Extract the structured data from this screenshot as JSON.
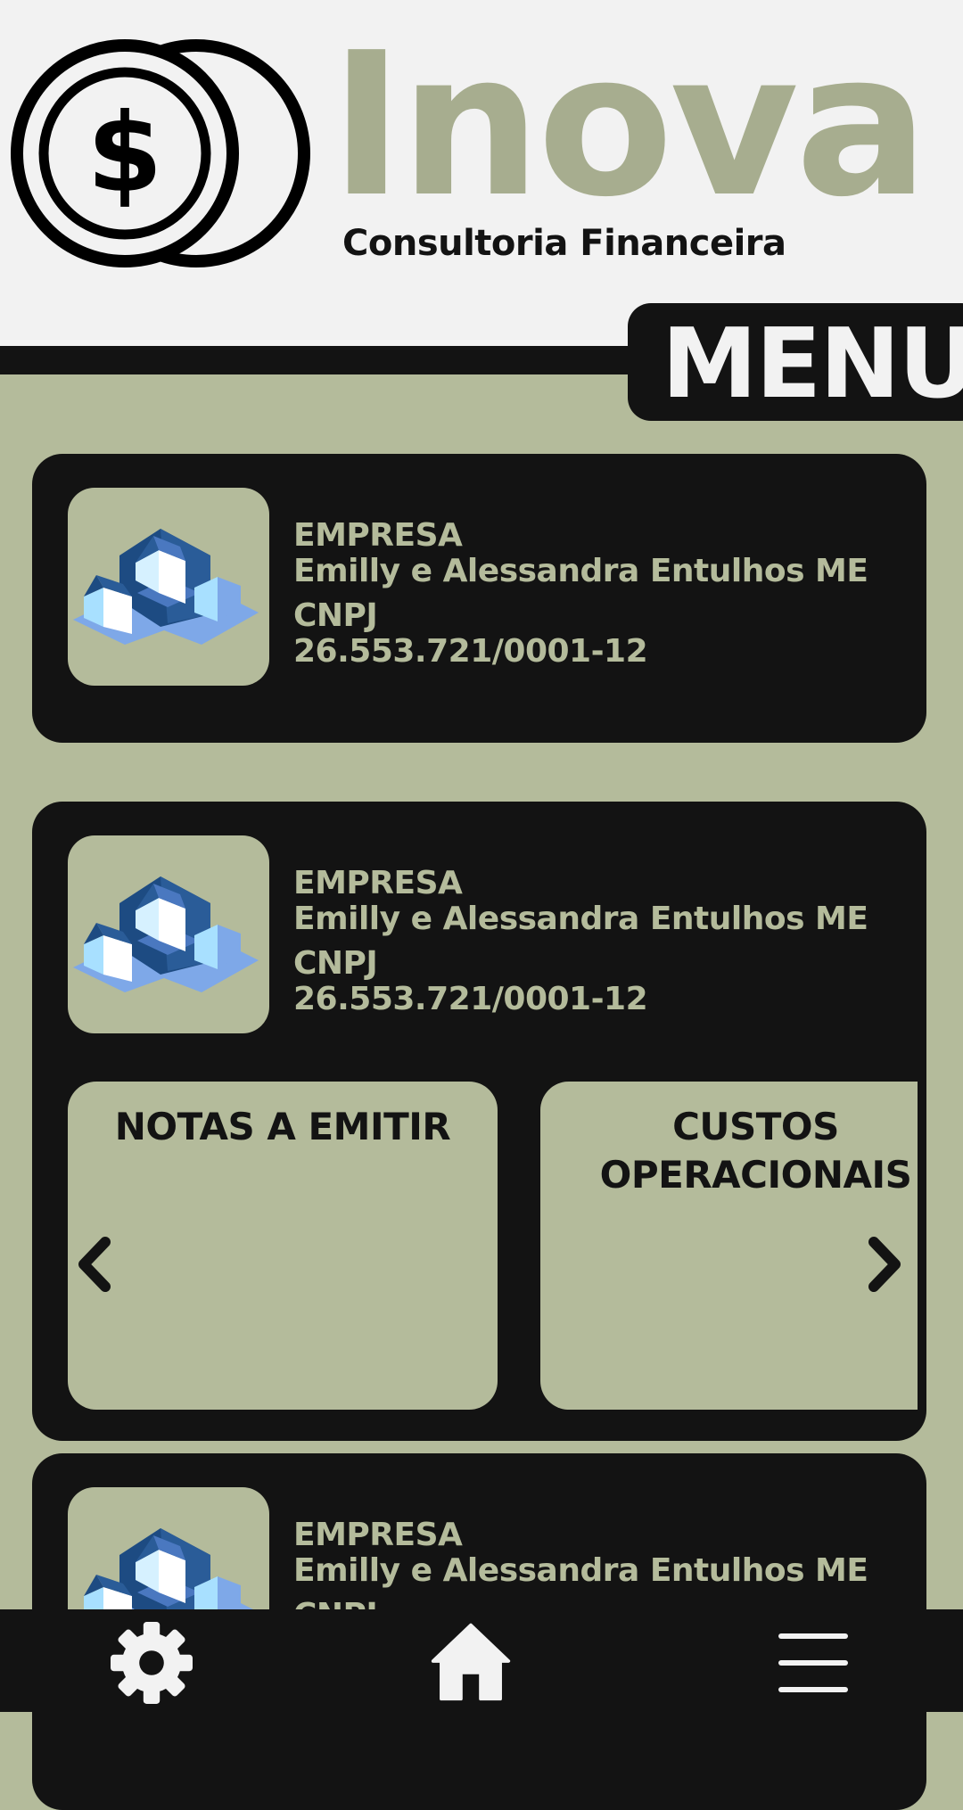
{
  "header": {
    "brand_name": "Inova",
    "tagline": "Consultoria Financeira",
    "logo_icon": "dollar-coins-icon",
    "menu_label": "MENU"
  },
  "companies": [
    {
      "logo_icon": "houses-blocks-icon",
      "company_label": "EMPRESA",
      "company_name": "Emilly e Alessandra Entulhos ME",
      "cnpj_label": "CNPJ",
      "cnpj_value": "26.553.721/0001-12"
    },
    {
      "logo_icon": "houses-blocks-icon",
      "company_label": "EMPRESA",
      "company_name": "Emilly e Alessandra Entulhos ME",
      "cnpj_label": "CNPJ",
      "cnpj_value": "26.553.721/0001-12",
      "expanded": true,
      "tiles": [
        {
          "title": "NOTAS A EMITIR"
        },
        {
          "title": "CUSTOS OPERACIONAIS"
        }
      ]
    },
    {
      "logo_icon": "houses-blocks-icon",
      "company_label": "EMPRESA",
      "company_name": "Emilly e Alessandra Entulhos ME",
      "cnpj_label": "CNPJ"
    }
  ],
  "bottom_nav": {
    "items": [
      {
        "icon": "gear-icon"
      },
      {
        "icon": "home-icon"
      },
      {
        "icon": "hamburger-menu-icon"
      }
    ]
  },
  "colors": {
    "background": "#b4bb9b",
    "dark": "#131313",
    "brand": "#a7ad8f",
    "header_background": "#f2f2f2"
  }
}
